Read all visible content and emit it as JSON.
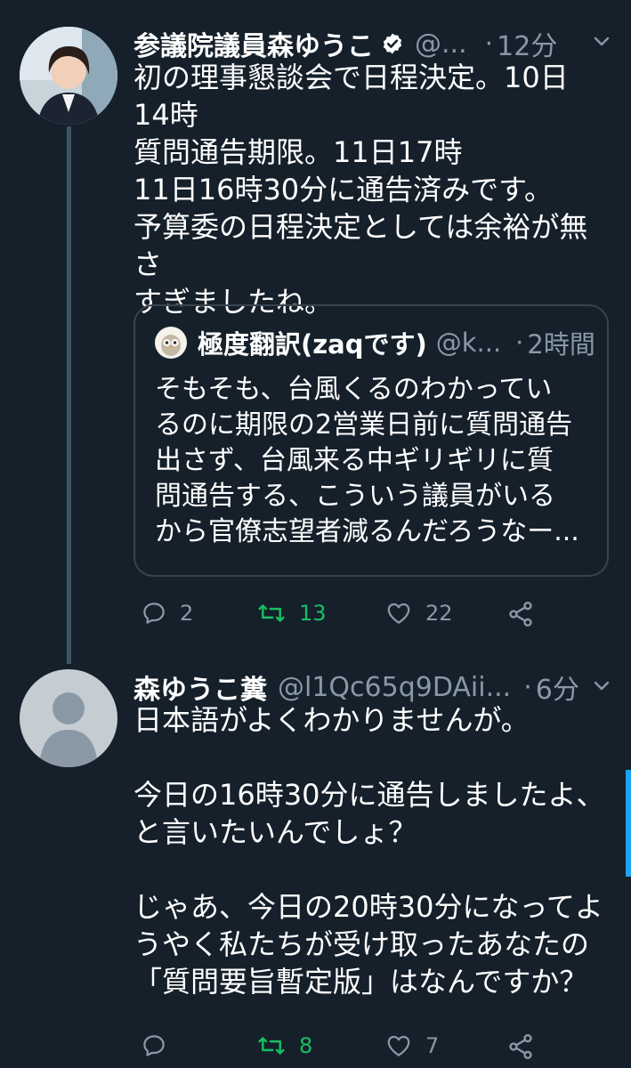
{
  "tweet1": {
    "display_name": "参議院議員森ゆうこ",
    "handle": "@...",
    "separator": "·",
    "time": "12分",
    "body": "初の理事懇談会で日程決定。10日\n14時\n質問通告期限。11日17時\n11日16時30分に通告済みです。\n予算委の日程決定としては余裕が無さ\nすぎましたね。",
    "quote": {
      "display_name": "極度翻訳(zaqです)",
      "handle": "@k...",
      "separator": "·",
      "time": "2時間",
      "body": "そもそも、台風くるのわかってい\nるのに期限の2営業日前に質問通告\n出さず、台風来る中ギリギリに質\n問通告する、こういう議員がいる\nから官僚志望者減るんだろうなー..."
    },
    "actions": {
      "replies": "2",
      "retweets": "13",
      "likes": "22"
    }
  },
  "tweet2": {
    "display_name": "森ゆうこ糞",
    "handle": "@l1Qc65q9DAii...",
    "separator": "·",
    "time": "6分",
    "body": "日本語がよくわかりませんが。\n\n今日の16時30分に通告しましたよ、\nと言いたいんでしょ？\n\nじゃあ、今日の20時30分になってよ\nうやく私たちが受け取ったあなたの\n「質問要旨暫定版」はなんですか？",
    "actions": {
      "replies": "",
      "retweets": "8",
      "likes": "7"
    }
  },
  "icons": {
    "verified": "verified-badge-icon",
    "caret": "chevron-down-icon",
    "reply": "reply-icon",
    "retweet": "retweet-icon",
    "like": "heart-icon",
    "share": "share-icon"
  },
  "colors": {
    "background": "#15202b",
    "secondary_text": "#8899a6",
    "retweet_active": "#17bf63",
    "accent": "#1da1f2",
    "thread_line": "#3d5466"
  }
}
